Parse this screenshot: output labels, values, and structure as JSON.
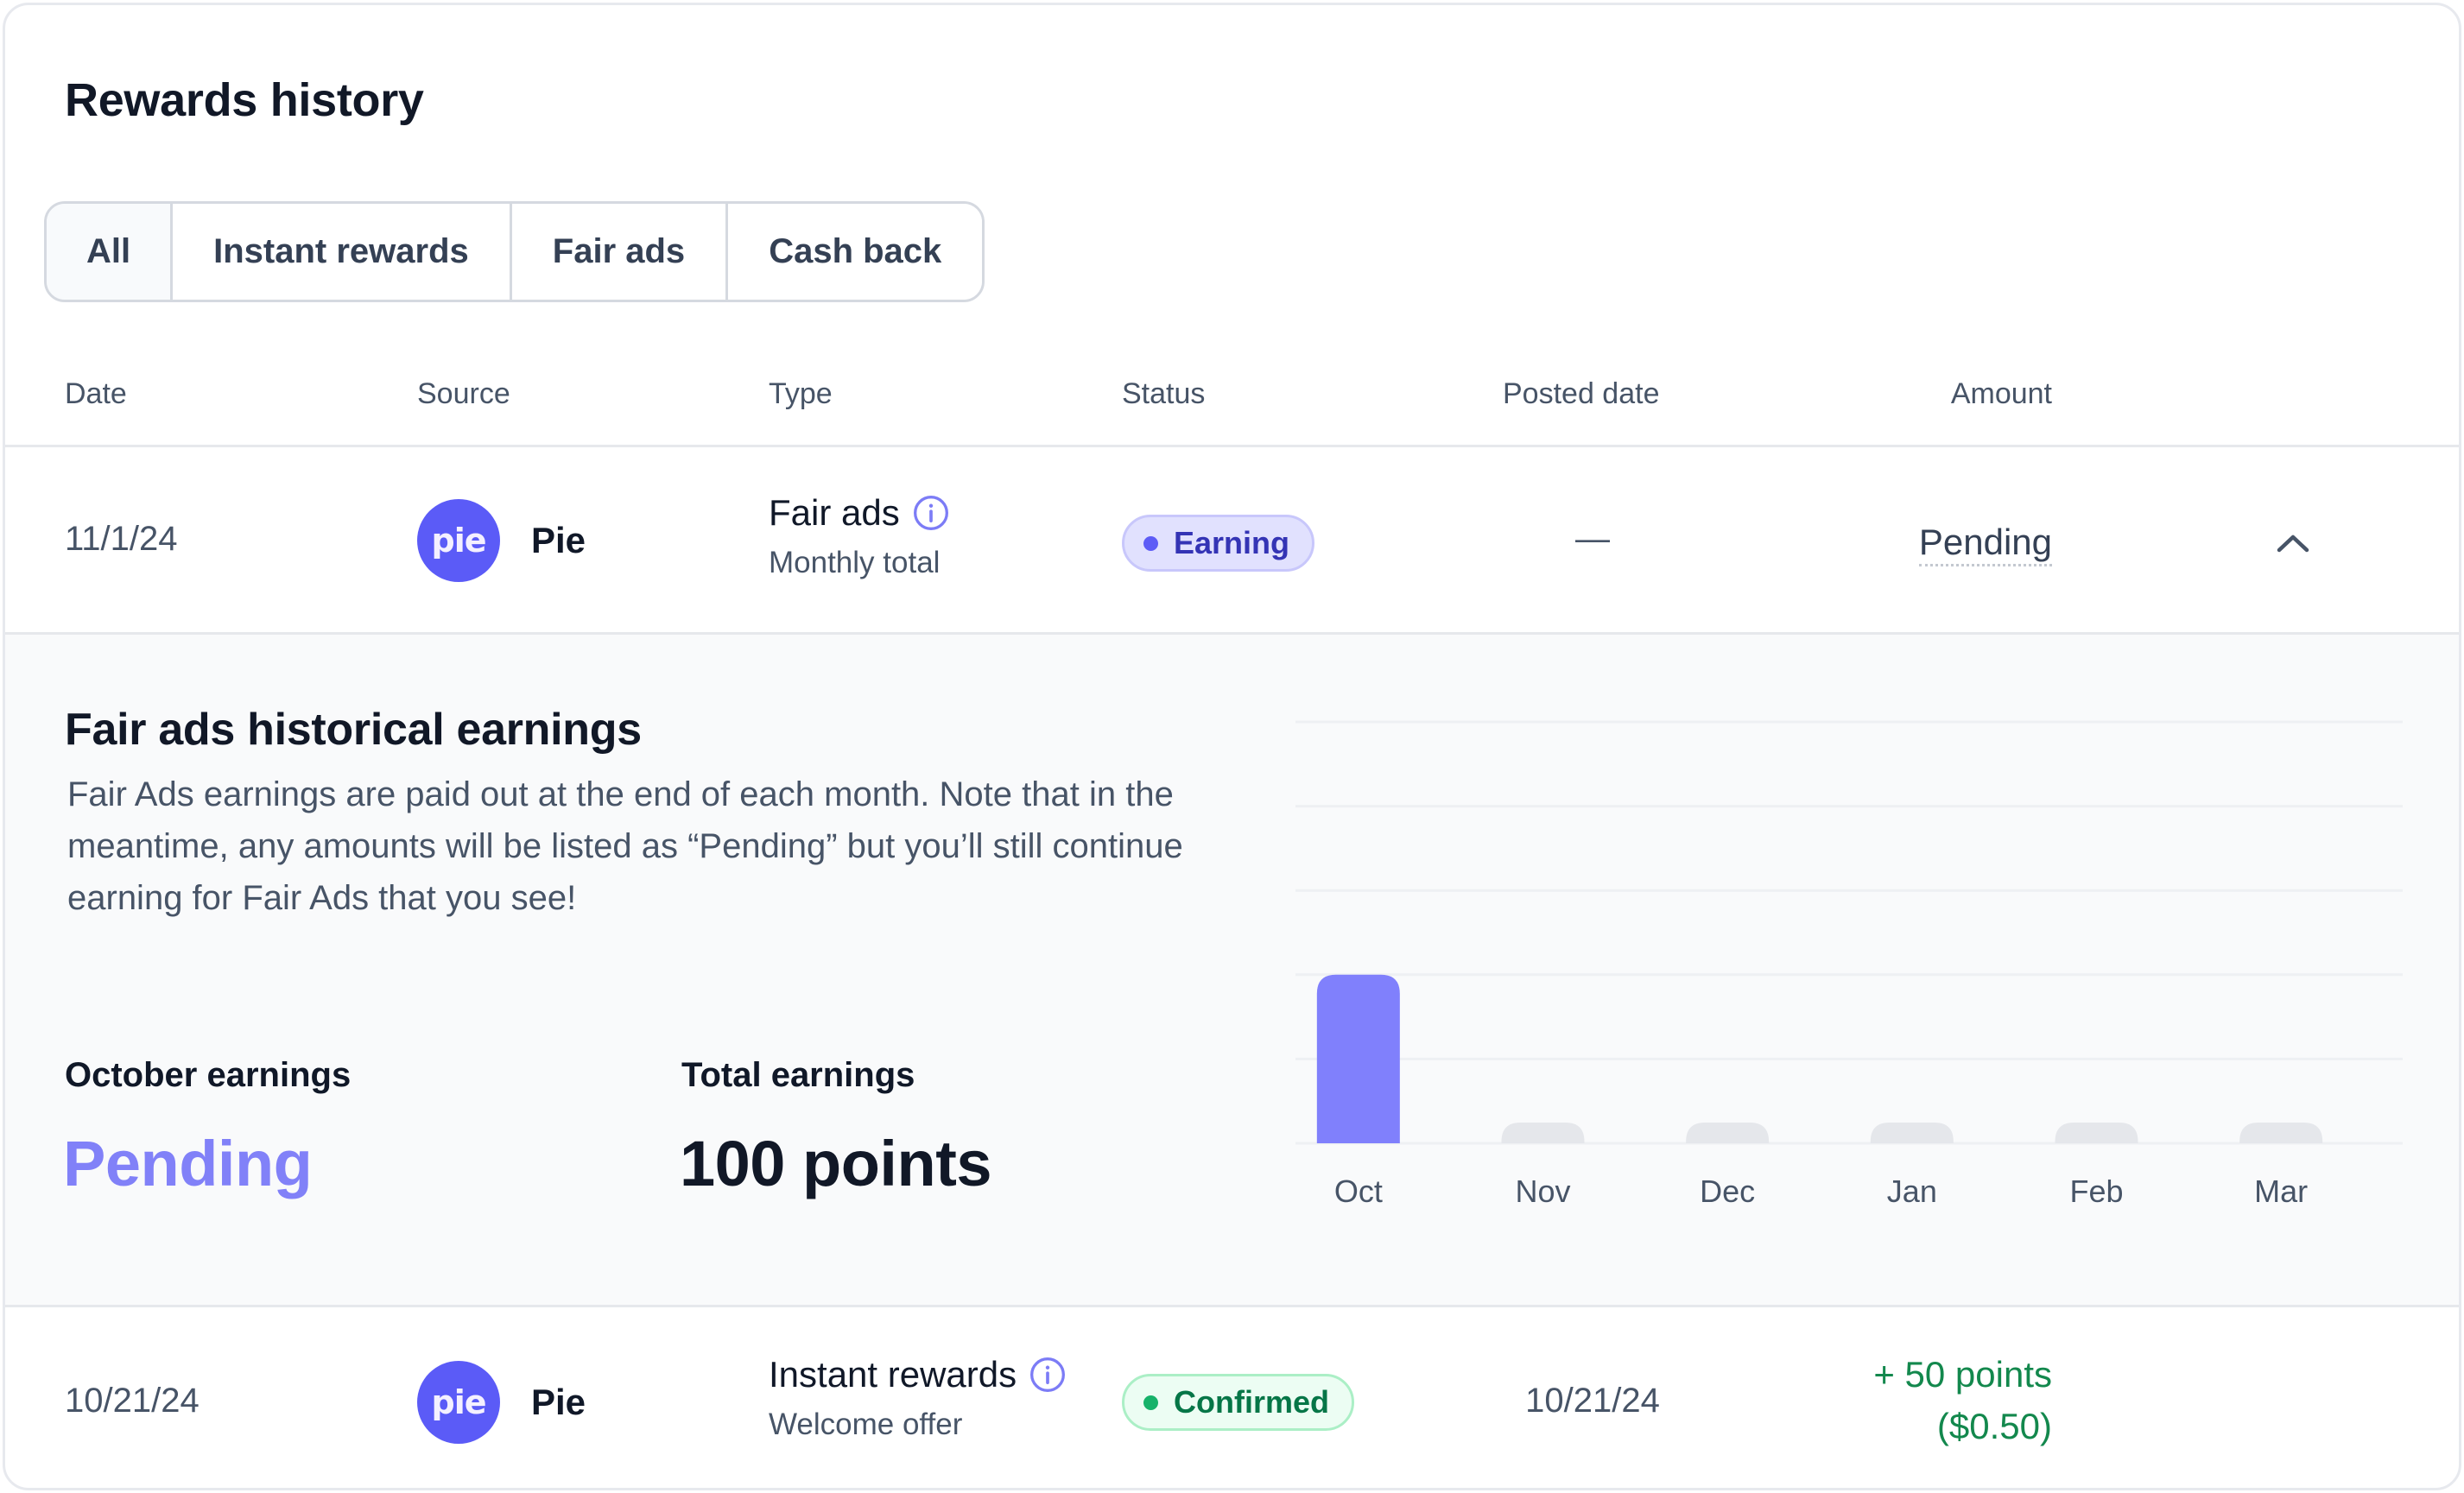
{
  "title": "Rewards history",
  "tabs": [
    {
      "label": "All",
      "active": true
    },
    {
      "label": "Instant rewards",
      "active": false
    },
    {
      "label": "Fair ads",
      "active": false
    },
    {
      "label": "Cash back",
      "active": false
    }
  ],
  "table": {
    "headers": {
      "date": "Date",
      "source": "Source",
      "type": "Type",
      "status": "Status",
      "posted_date": "Posted date",
      "amount": "Amount"
    },
    "rows": [
      {
        "date": "11/1/24",
        "source_logo_text": "pie",
        "source": "Pie",
        "type": "Fair ads",
        "type_sub": "Monthly total",
        "status": "Earning",
        "posted_date": "—",
        "amount": "Pending",
        "expanded": true,
        "toggle_icon": "chevron-up-icon"
      },
      {
        "date": "10/21/24",
        "source_logo_text": "pie",
        "source": "Pie",
        "type": "Instant rewards",
        "type_sub": "Welcome offer",
        "status": "Confirmed",
        "posted_date": "10/21/24",
        "amount_line1": "+ 50 points",
        "amount_line2": "($0.50)"
      }
    ]
  },
  "panel": {
    "title": "Fair ads historical earnings",
    "description": "Fair Ads earnings are paid out at the end of each month. Note that in the meantime, any amounts will be listed as “Pending” but you’ll still continue earning for Fair Ads that you see!",
    "october_label": "October earnings",
    "october_value": "Pending",
    "total_label": "Total earnings",
    "total_value": "100 points"
  },
  "colors": {
    "brand": "#5b5bf7",
    "bar_active": "#8080fc",
    "bar_placeholder": "#e5e7eb",
    "gridline": "#eef0f3",
    "earning_badge_text": "#3434b5",
    "confirmed_badge_text": "#067647",
    "positive_amount": "#13884d"
  },
  "chart_data": {
    "type": "bar",
    "title": "",
    "xlabel": "",
    "ylabel": "",
    "categories": [
      "Oct",
      "Nov",
      "Dec",
      "Jan",
      "Feb",
      "Mar"
    ],
    "values": [
      0.4,
      0,
      0,
      0,
      0,
      0
    ],
    "value_units": "fraction of axis max (no y-axis ticks shown)",
    "placeholder_for_empty": true,
    "highlighted": [
      "Oct"
    ],
    "ylim": [
      0,
      1
    ],
    "gridlines": 6,
    "grid": true,
    "legend": "none"
  }
}
